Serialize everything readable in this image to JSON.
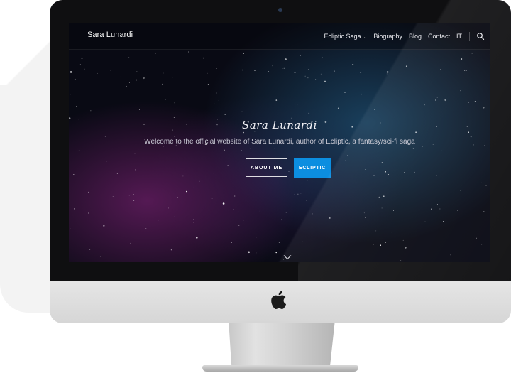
{
  "site": {
    "brand": "Sara Lunardi"
  },
  "nav": {
    "items": [
      {
        "label": "Ecliptic Saga",
        "has_dropdown": true
      },
      {
        "label": "Biography",
        "has_dropdown": false
      },
      {
        "label": "Blog",
        "has_dropdown": false
      },
      {
        "label": "Contact",
        "has_dropdown": false
      },
      {
        "label": "IT",
        "has_dropdown": false
      }
    ],
    "caret_glyph": "⌄",
    "search_icon": "search-icon"
  },
  "hero": {
    "title": "Sara Lunardi",
    "subtitle": "Welcome to the official website of Sara Lunardi, author of Ecliptic, a fantasy/sci-fi saga",
    "buttons": {
      "about": "ABOUT ME",
      "ecliptic": "ECLIPTIC"
    },
    "scroll_icon": "chevron-down-icon"
  },
  "device": {
    "type": "desktop monitor mockup",
    "logo_icon": "apple-logo-icon"
  },
  "colors": {
    "accent": "#0c8ee0",
    "bezel": "#0f0f11",
    "chin": "#dcdcdc",
    "nebula_purple": "#621c5f",
    "nebula_blue": "#1c4868"
  }
}
